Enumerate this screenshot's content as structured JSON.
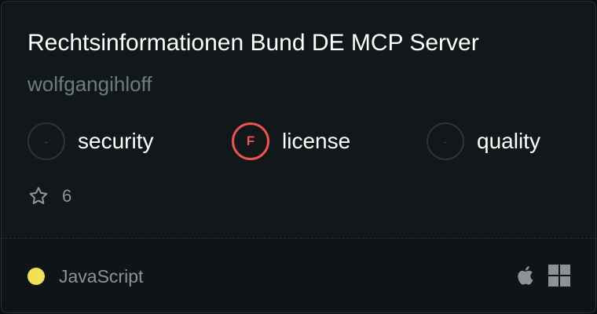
{
  "server": {
    "name": "Rechtsinformationen Bund DE MCP Server",
    "author": "wolfgangihloff"
  },
  "metrics": [
    {
      "grade": "-",
      "label": "security",
      "state": "none"
    },
    {
      "grade": "F",
      "label": "license",
      "state": "fail"
    },
    {
      "grade": "-",
      "label": "quality",
      "state": "none"
    }
  ],
  "stars": {
    "count": "6",
    "icon": "star-outline-icon"
  },
  "footer": {
    "language": "JavaScript",
    "language_color": "#f1e05a",
    "platform_icons": [
      "apple-icon",
      "windows-icon"
    ]
  },
  "colors": {
    "fail_red": "#f05252",
    "muted_author": "#6b7e7f"
  }
}
